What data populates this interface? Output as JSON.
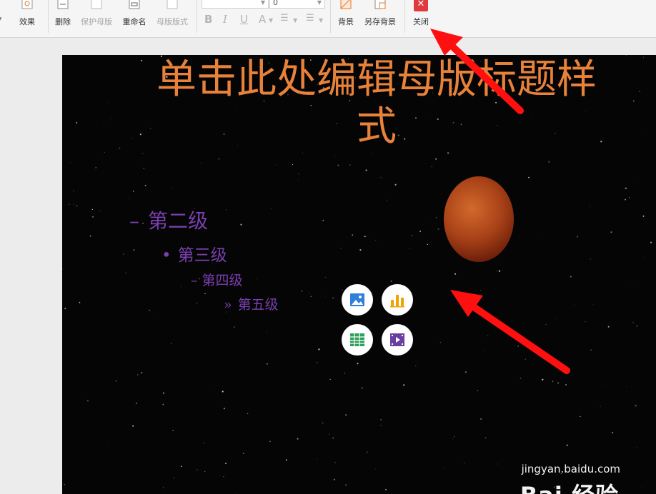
{
  "ribbon": {
    "effects_label": "效果",
    "delete_label": "删除",
    "protect_master_label": "保护母版",
    "rename_label": "重命名",
    "master_layout_label": "母版版式",
    "font_size_value": "0",
    "bold_label": "B",
    "italic_label": "I",
    "underline_label": "U",
    "font_color_label": "A",
    "background_label": "背景",
    "save_background_label": "另存背景",
    "close_label": "关闭"
  },
  "slide": {
    "title": "单击此处编辑母版标题样式",
    "levels": {
      "level2": {
        "bullet": "–",
        "text": "第二级"
      },
      "level3": {
        "bullet": "•",
        "text": "第三级"
      },
      "level4": {
        "bullet": "–",
        "text": "第四级"
      },
      "level5": {
        "bullet": "»",
        "text": "第五级"
      }
    },
    "placeholder_icons": [
      "picture-icon",
      "chart-icon",
      "table-icon",
      "video-icon"
    ]
  },
  "watermark": {
    "brand": "Bai 经验",
    "url": "jingyan.baidu.com"
  },
  "colors": {
    "title": "#e8823a",
    "levels": "#7a3fb0",
    "slide_bg": "#050505",
    "close": "#e0393e",
    "annotation_arrow": "#ff1010"
  }
}
